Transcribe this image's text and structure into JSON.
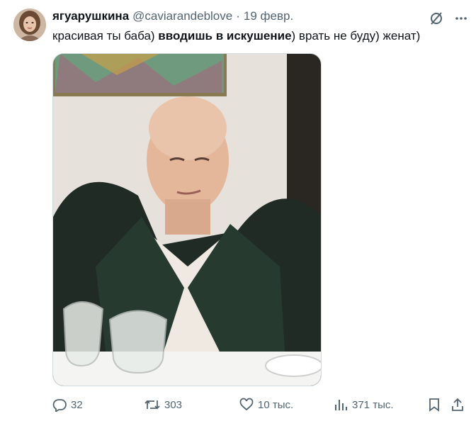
{
  "author": {
    "display_name": "ягуарушкина",
    "handle": "@caviarandeblove",
    "separator": "·",
    "date": "19 февр."
  },
  "tweet": {
    "text_before": "красивая ты баба) ",
    "text_bold": "вводишь в искушение",
    "text_after": ") врать не буду) женат)"
  },
  "actions": {
    "replies": "32",
    "retweets": "303",
    "likes": "10 тыс.",
    "views": "371 тыс."
  },
  "icons": {
    "header": [
      "grok-icon",
      "more-icon"
    ],
    "actions": [
      "reply-icon",
      "retweet-icon",
      "like-icon",
      "views-icon",
      "bookmark-icon",
      "share-icon"
    ]
  },
  "colors": {
    "text": "#0f1419",
    "secondary": "#536471",
    "border": "#cfd9de"
  }
}
